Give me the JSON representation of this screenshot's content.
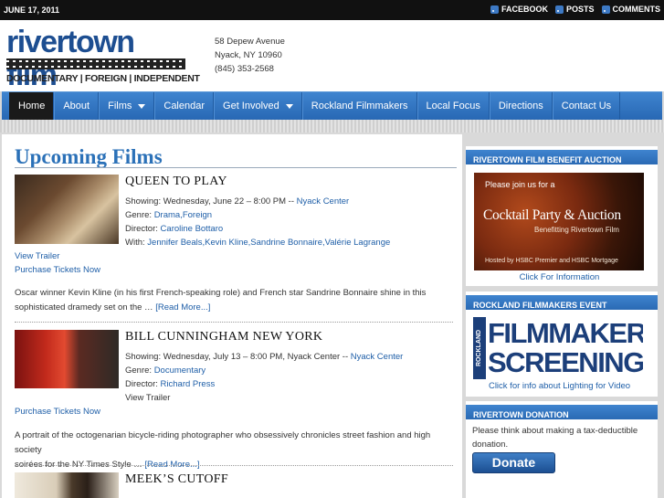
{
  "topbar": {
    "date": "JUNE 17, 2011",
    "links": [
      {
        "label": "FACEBOOK",
        "icon": "rss-icon"
      },
      {
        "label": "POSTS",
        "icon": "rss-icon"
      },
      {
        "label": "COMMENTS",
        "icon": "rss-icon"
      }
    ]
  },
  "header": {
    "logo_text": "rivertown film",
    "logo_tagline": "DOCUMENTARY | FOREIGN | INDEPENDENT",
    "address_line1": "58 Depew Avenue",
    "address_line2": "Nyack, NY 10960",
    "phone": "(845) 353-2568"
  },
  "nav": {
    "items": [
      {
        "label": "Home",
        "active": true
      },
      {
        "label": "About"
      },
      {
        "label": "Films",
        "dropdown": true
      },
      {
        "label": "Calendar"
      },
      {
        "label": "Get Involved",
        "dropdown": true
      },
      {
        "label": "Rockland Filmmakers"
      },
      {
        "label": "Local Focus"
      },
      {
        "label": "Directions"
      },
      {
        "label": "Contact Us"
      }
    ]
  },
  "main": {
    "title": "Upcoming Films",
    "films": [
      {
        "title": "QUEEN TO PLAY",
        "showing_prefix": "Showing: Wednesday, June 22 – 8:00 PM -- ",
        "venue": "Nyack Center",
        "genre_prefix": "Genre: ",
        "genres": "Drama,Foreign",
        "director_prefix": "Director: ",
        "director": "Caroline Bottaro",
        "with_prefix": "With: ",
        "cast": "Jennifer Beals,Kevin Kline,Sandrine Bonnaire,Valérie Lagrange",
        "trailer": "View Trailer",
        "tickets": "Purchase Tickets Now",
        "description": "Oscar winner Kevin Kline (in his first French-speaking role) and French star Sandrine Bonnaire shine in this sophisticated dramedy set on the … ",
        "read_more": "[Read More...]"
      },
      {
        "title": "BILL CUNNINGHAM NEW YORK",
        "showing_prefix": "Showing: Wednesday, July 13 – 8:00 PM, Nyack Center -- ",
        "venue": "Nyack Center",
        "genre_prefix": "Genre: ",
        "genres": "Documentary",
        "director_prefix": "Director: ",
        "director": "Richard Press",
        "trailer": "View Trailer",
        "tickets": "Purchase Tickets Now",
        "description_line1": "A portrait of the octogenarian bicycle-riding photographer who obsessively chronicles street fashion and high society",
        "description_line2": "soirées for the NY Times Style … ",
        "read_more": "[Read More...]"
      },
      {
        "title": "MEEK’S CUTOFF"
      }
    ]
  },
  "sidebar": {
    "auction": {
      "heading": "RIVERTOWN FILM BENEFIT AUCTION",
      "img_line1": "Please join us for a",
      "img_line2": "Cocktail Party & Auction",
      "img_line3": "Benefitting Rivertown Film",
      "img_line4": "Hosted by HSBC Premier and HSBC Mortgage",
      "link": "Click For Information"
    },
    "filmmakers": {
      "heading": "ROCKLAND FILMMAKERS EVENT",
      "img_side": "ROCKLAND",
      "img_line1": "FILMMAKERS",
      "img_line2": "SCREENINGS",
      "link": "Click for info about Lighting for Video"
    },
    "donation": {
      "heading": "RIVERTOWN DONATION",
      "text": "Please think about making a tax-deductible donation.",
      "button": "Donate"
    }
  },
  "colors": {
    "accent": "#2b71b8",
    "nav": "#3f84cf",
    "link": "#1f5fa8",
    "topbar": "#111111"
  }
}
